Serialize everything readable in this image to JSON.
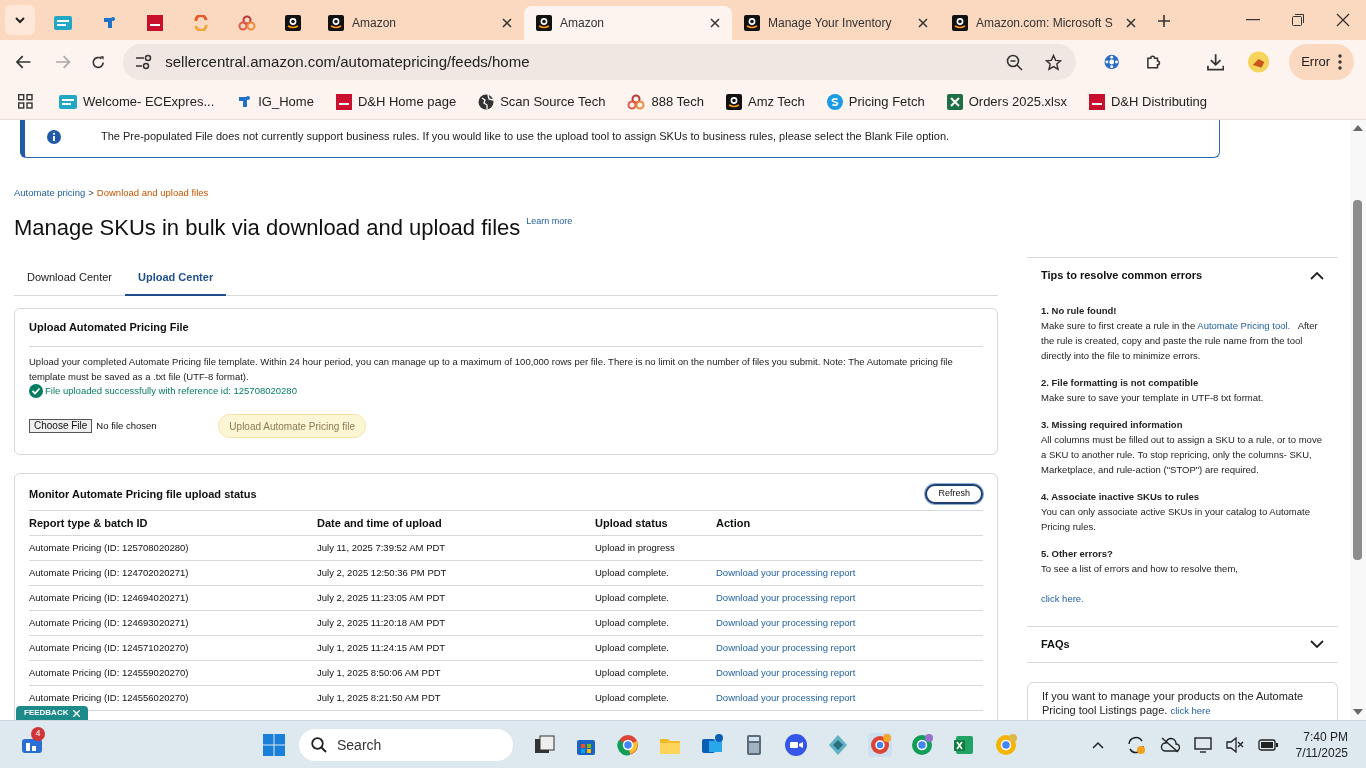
{
  "browser": {
    "tabs": [
      {
        "kind": "pinned",
        "selected": false
      },
      {
        "kind": "pinned",
        "selected": false
      },
      {
        "kind": "pinned",
        "selected": false
      },
      {
        "kind": "pinned",
        "selected": false
      },
      {
        "kind": "pinned",
        "selected": false
      },
      {
        "kind": "pinned",
        "selected": false
      },
      {
        "kind": "tab",
        "title": "Amazon",
        "selected": false
      },
      {
        "kind": "tab",
        "title": "Amazon",
        "selected": true
      },
      {
        "kind": "tab",
        "title": "Manage Your Inventory",
        "selected": false
      },
      {
        "kind": "tab",
        "title": "Amazon.com: Microsoft S",
        "selected": false
      }
    ],
    "address": "sellercentral.amazon.com/automatepricing/feeds/home",
    "profile_button": "Error",
    "bookmarks": [
      "Welcome- ECExpres...",
      "IG_Home",
      "D&H Home page",
      "Scan Source Tech",
      "888 Tech",
      "Amz Tech",
      "Pricing Fetch",
      "Orders 2025.xlsx",
      "D&H Distributing"
    ]
  },
  "page": {
    "notice": "The Pre-populated File does not currently support business rules. If you would like to use the upload tool to assign SKUs to business rules, please select the Blank File option.",
    "breadcrumb_separator": ">",
    "breadcrumb": [
      {
        "label": "Automate pricing",
        "current": false
      },
      {
        "label": "Download and upload files",
        "current": true
      }
    ],
    "heading": "Manage SKUs in bulk via download and upload files",
    "learn_more": "Learn more",
    "tabs": [
      {
        "label": "Download Center",
        "selected": false
      },
      {
        "label": "Upload Center",
        "selected": true
      }
    ],
    "upload_card": {
      "title": "Upload Automated Pricing File",
      "description": "Upload your completed Automate Pricing file template. Within 24 hour period, you can manage up to a maximum of 100,000 rows per file. There is no limit on the number of files you submit. Note: The Automate pricing file template must be saved as a .txt file (UTF-8 format).",
      "success_message": "File uploaded successfully with reference id: 125708020280",
      "file_button": "Choose File",
      "file_status": "No file chosen",
      "upload_button": "Upload Automate Pricing file"
    },
    "monitor": {
      "title": "Monitor Automate Pricing file upload status",
      "refresh_button": "Refresh",
      "columns": [
        "Report type & batch ID",
        "Date and time of upload",
        "Upload status",
        "Action"
      ],
      "rows": [
        {
          "report": "Automate Pricing (ID: 125708020280)",
          "date": "July 11, 2025 7:39:52 AM PDT",
          "status": "Upload in progress"
        },
        {
          "report": "Automate Pricing (ID: 124702020271)",
          "date": "July 2, 2025 12:50:36 PM PDT",
          "status": "Upload complete.",
          "action": "Download your processing report"
        },
        {
          "report": "Automate Pricing (ID: 124694020271)",
          "date": "July 2, 2025 11:23:05 AM PDT",
          "status": "Upload complete.",
          "action": "Download your processing report"
        },
        {
          "report": "Automate Pricing (ID: 124693020271)",
          "date": "July 2, 2025 11:20:18 AM PDT",
          "status": "Upload complete.",
          "action": "Download your processing report"
        },
        {
          "report": "Automate Pricing (ID: 124571020270)",
          "date": "July 1, 2025 11:24:15 AM PDT",
          "status": "Upload complete.",
          "action": "Download your processing report"
        },
        {
          "report": "Automate Pricing (ID: 124559020270)",
          "date": "July 1, 2025 8:50:06 AM PDT",
          "status": "Upload complete.",
          "action": "Download your processing report"
        },
        {
          "report": "Automate Pricing (ID: 124556020270)",
          "date": "July 1, 2025 8:21:50 AM PDT",
          "status": "Upload complete.",
          "action": "Download your processing report"
        }
      ]
    },
    "tips": {
      "title": "Tips to resolve common errors",
      "expanded": true,
      "items": [
        {
          "heading": "1. No rule found!",
          "text": "Make sure to first create a rule in the",
          "link": "Automate Pricing tool.",
          "text_after": "After the rule is created, copy and paste the rule name from the tool directly into the file to minimize errors."
        },
        {
          "heading": "2. File formatting is not compatible",
          "text": "Make sure to save your template in UTF-8 txt format."
        },
        {
          "heading": "3. Missing required information",
          "text": "All columns must be filled out to assign a SKU to a rule, or to move a SKU to another rule. To stop repricing, only the columns- SKU, Marketplace, and rule-action (\"STOP\") are required."
        },
        {
          "heading": "4. Associate inactive SKUs to rules",
          "text": "You can only associate active SKUs in your catalog to Automate Pricing rules."
        },
        {
          "heading": "5. Other errors?",
          "text": "To see a list of errors and how to resolve them,",
          "link_below": "click here."
        }
      ]
    },
    "faqs": {
      "title": "FAQs",
      "expanded": false
    },
    "listing_box": {
      "text": "If you want to manage your products on the Automate Pricing tool Listings page.",
      "link": "click here"
    },
    "feedback": "FEEDBACK"
  },
  "taskbar": {
    "widget_badge": "4",
    "search_placeholder": "Search",
    "time": "7:40 PM",
    "date": "7/11/2025"
  }
}
